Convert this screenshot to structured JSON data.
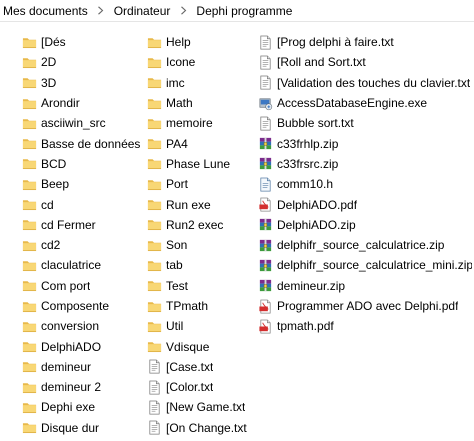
{
  "breadcrumb": [
    "Mes documents",
    "Ordinateur",
    "Dephi programme"
  ],
  "colors": {
    "folder_body": "#F8D775",
    "folder_tab": "#E8B94A",
    "pdf_red": "#D32F2F",
    "zip_stack": [
      "#7B2C8C",
      "#2F6FB5",
      "#3C9A3C"
    ]
  },
  "columns": [
    [
      {
        "name": "[Dés",
        "icon": "folder-icon"
      },
      {
        "name": "2D",
        "icon": "folder-icon"
      },
      {
        "name": "3D",
        "icon": "folder-icon"
      },
      {
        "name": "Arondir",
        "icon": "folder-icon"
      },
      {
        "name": "asciiwin_src",
        "icon": "folder-icon"
      },
      {
        "name": "Basse de données",
        "icon": "folder-icon"
      },
      {
        "name": "BCD",
        "icon": "folder-icon"
      },
      {
        "name": "Beep",
        "icon": "folder-icon"
      },
      {
        "name": "cd",
        "icon": "folder-icon"
      },
      {
        "name": "cd Fermer",
        "icon": "folder-icon"
      },
      {
        "name": "cd2",
        "icon": "folder-icon"
      },
      {
        "name": "claculatrice",
        "icon": "folder-icon"
      },
      {
        "name": "Com port",
        "icon": "folder-icon"
      },
      {
        "name": "Composente",
        "icon": "folder-icon"
      },
      {
        "name": "conversion",
        "icon": "folder-icon"
      },
      {
        "name": "DelphiADO",
        "icon": "folder-icon"
      },
      {
        "name": "demineur",
        "icon": "folder-icon"
      },
      {
        "name": "demineur 2",
        "icon": "folder-icon"
      },
      {
        "name": "Dephi exe",
        "icon": "folder-icon"
      },
      {
        "name": "Disque dur",
        "icon": "folder-icon"
      }
    ],
    [
      {
        "name": "Help",
        "icon": "folder-icon"
      },
      {
        "name": "Icone",
        "icon": "folder-icon"
      },
      {
        "name": "imc",
        "icon": "folder-icon"
      },
      {
        "name": "Math",
        "icon": "folder-icon"
      },
      {
        "name": "memoire",
        "icon": "folder-icon"
      },
      {
        "name": "PA4",
        "icon": "folder-icon"
      },
      {
        "name": "Phase Lune",
        "icon": "folder-icon"
      },
      {
        "name": "Port",
        "icon": "folder-icon"
      },
      {
        "name": "Run exe",
        "icon": "folder-icon"
      },
      {
        "name": "Run2 exec",
        "icon": "folder-icon"
      },
      {
        "name": "Son",
        "icon": "folder-icon"
      },
      {
        "name": "tab",
        "icon": "folder-icon"
      },
      {
        "name": "Test",
        "icon": "folder-icon"
      },
      {
        "name": "TPmath",
        "icon": "folder-icon"
      },
      {
        "name": "Util",
        "icon": "folder-icon"
      },
      {
        "name": "Vdisque",
        "icon": "folder-icon"
      },
      {
        "name": "[Case.txt",
        "icon": "text-file-icon"
      },
      {
        "name": "[Color.txt",
        "icon": "text-file-icon"
      },
      {
        "name": "[New Game.txt",
        "icon": "text-file-icon"
      },
      {
        "name": "[On Change.txt",
        "icon": "text-file-icon"
      }
    ],
    [
      {
        "name": "[Prog delphi à faire.txt",
        "icon": "text-file-icon"
      },
      {
        "name": "[Roll and Sort.txt",
        "icon": "text-file-icon"
      },
      {
        "name": "[Validation des touches du clavier.txt",
        "icon": "text-file-icon"
      },
      {
        "name": "AccessDatabaseEngine.exe",
        "icon": "installer-icon"
      },
      {
        "name": "Bubble sort.txt",
        "icon": "text-file-icon"
      },
      {
        "name": "c33frhlp.zip",
        "icon": "zip-archive-icon"
      },
      {
        "name": "c33frsrc.zip",
        "icon": "zip-archive-icon"
      },
      {
        "name": "comm10.h",
        "icon": "header-file-icon"
      },
      {
        "name": "DelphiADO.pdf",
        "icon": "pdf-file-icon"
      },
      {
        "name": "DelphiADO.zip",
        "icon": "zip-archive-icon"
      },
      {
        "name": "delphifr_source_calculatrice.zip",
        "icon": "zip-archive-icon"
      },
      {
        "name": "delphifr_source_calculatrice_mini.zip",
        "icon": "zip-archive-icon"
      },
      {
        "name": "demineur.zip",
        "icon": "zip-archive-icon"
      },
      {
        "name": "Programmer ADO avec Delphi.pdf",
        "icon": "pdf-file-icon"
      },
      {
        "name": "tpmath.pdf",
        "icon": "pdf-file-icon"
      }
    ]
  ]
}
